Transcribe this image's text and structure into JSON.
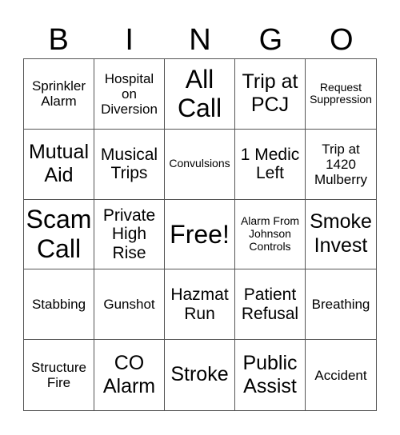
{
  "header": [
    "B",
    "I",
    "N",
    "G",
    "O"
  ],
  "cells": [
    "Sprinkler Alarm",
    "Hospital on Diversion",
    "All Call",
    "Trip at PCJ",
    "Request Suppression",
    "Mutual Aid",
    "Musical Trips",
    "Convulsions",
    "1 Medic Left",
    "Trip at 1420 Mulberry",
    "Scam Call",
    "Private High Rise",
    "Free!",
    "Alarm From Johnson Controls",
    "Smoke Invest",
    "Stabbing",
    "Gunshot",
    "Hazmat Run",
    "Patient Refusal",
    "Breathing",
    "Structure Fire",
    "CO Alarm",
    "Stroke",
    "Public Assist",
    "Accident"
  ]
}
